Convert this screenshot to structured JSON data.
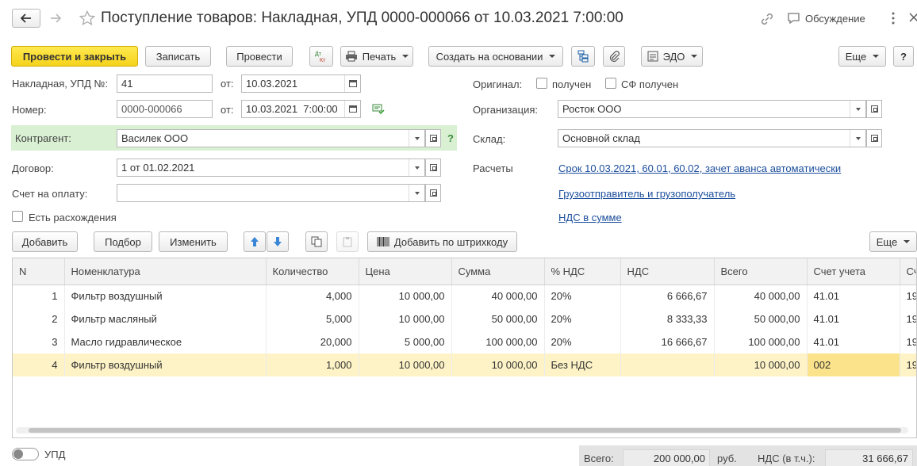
{
  "window": {
    "title": "Поступление товаров: Накладная, УПД 0000-000066 от 10.03.2021 7:00:00",
    "discussion_label": "Обсуждение"
  },
  "toolbar": {
    "post_close": "Провести и закрыть",
    "save": "Записать",
    "post": "Провести",
    "dtkt": "Дт Кт",
    "print": "Печать",
    "create_based": "Создать на основании",
    "edo": "ЭДО",
    "more": "Еще",
    "help": "?"
  },
  "form": {
    "invoice_label": "Накладная, УПД №:",
    "invoice_no": "41",
    "from_label": "от:",
    "invoice_date": "10.03.2021",
    "number_label": "Номер:",
    "number": "0000-000066",
    "doc_date": "10.03.2021  7:00:00",
    "counterparty_label": "Контрагент:",
    "counterparty": "Василек ООО",
    "counterparty_help": "?",
    "contract_label": "Договор:",
    "contract": "1 от 01.02.2021",
    "payment_invoice_label": "Счет на оплату:",
    "payment_invoice": "",
    "discrepancies_label": "Есть расхождения",
    "original_label": "Оригинал:",
    "received_label": "получен",
    "sf_received_label": "СФ получен",
    "organization_label": "Организация:",
    "organization": "Росток ООО",
    "warehouse_label": "Склад:",
    "warehouse": "Основной склад",
    "settlements_label": "Расчеты",
    "settlements_link": "Срок 10.03.2021, 60.01, 60.02, зачет аванса автоматически",
    "shipper_link": "Грузоотправитель и грузополучатель",
    "vat_link": "НДС в сумме"
  },
  "table_toolbar": {
    "add": "Добавить",
    "select": "Подбор",
    "edit": "Изменить",
    "add_barcode": "Добавить по штрихкоду",
    "more": "Еще"
  },
  "table": {
    "headers": [
      "N",
      "Номенклатура",
      "Количество",
      "Цена",
      "Сумма",
      "% НДС",
      "НДС",
      "Всего",
      "Счет учета",
      "Сч"
    ],
    "rows": [
      [
        "1",
        "Фильтр воздушный",
        "4,000",
        "10 000,00",
        "40 000,00",
        "20%",
        "6 666,67",
        "40 000,00",
        "41.01",
        "19"
      ],
      [
        "2",
        "Фильтр масляный",
        "5,000",
        "10 000,00",
        "50 000,00",
        "20%",
        "8 333,33",
        "50 000,00",
        "41.01",
        "19"
      ],
      [
        "3",
        "Масло гидравлическое",
        "20,000",
        "5 000,00",
        "100 000,00",
        "20%",
        "16 666,67",
        "100 000,00",
        "41.01",
        "19"
      ],
      [
        "4",
        "Фильтр воздушный",
        "1,000",
        "10 000,00",
        "10 000,00",
        "Без НДС",
        "",
        "10 000,00",
        "002",
        "19"
      ]
    ]
  },
  "footer": {
    "upd_label": "УПД",
    "total_label": "Всего:",
    "total": "200 000,00",
    "currency": "руб.",
    "vat_label": "НДС (в т.ч.):",
    "vat": "31 666,67"
  }
}
